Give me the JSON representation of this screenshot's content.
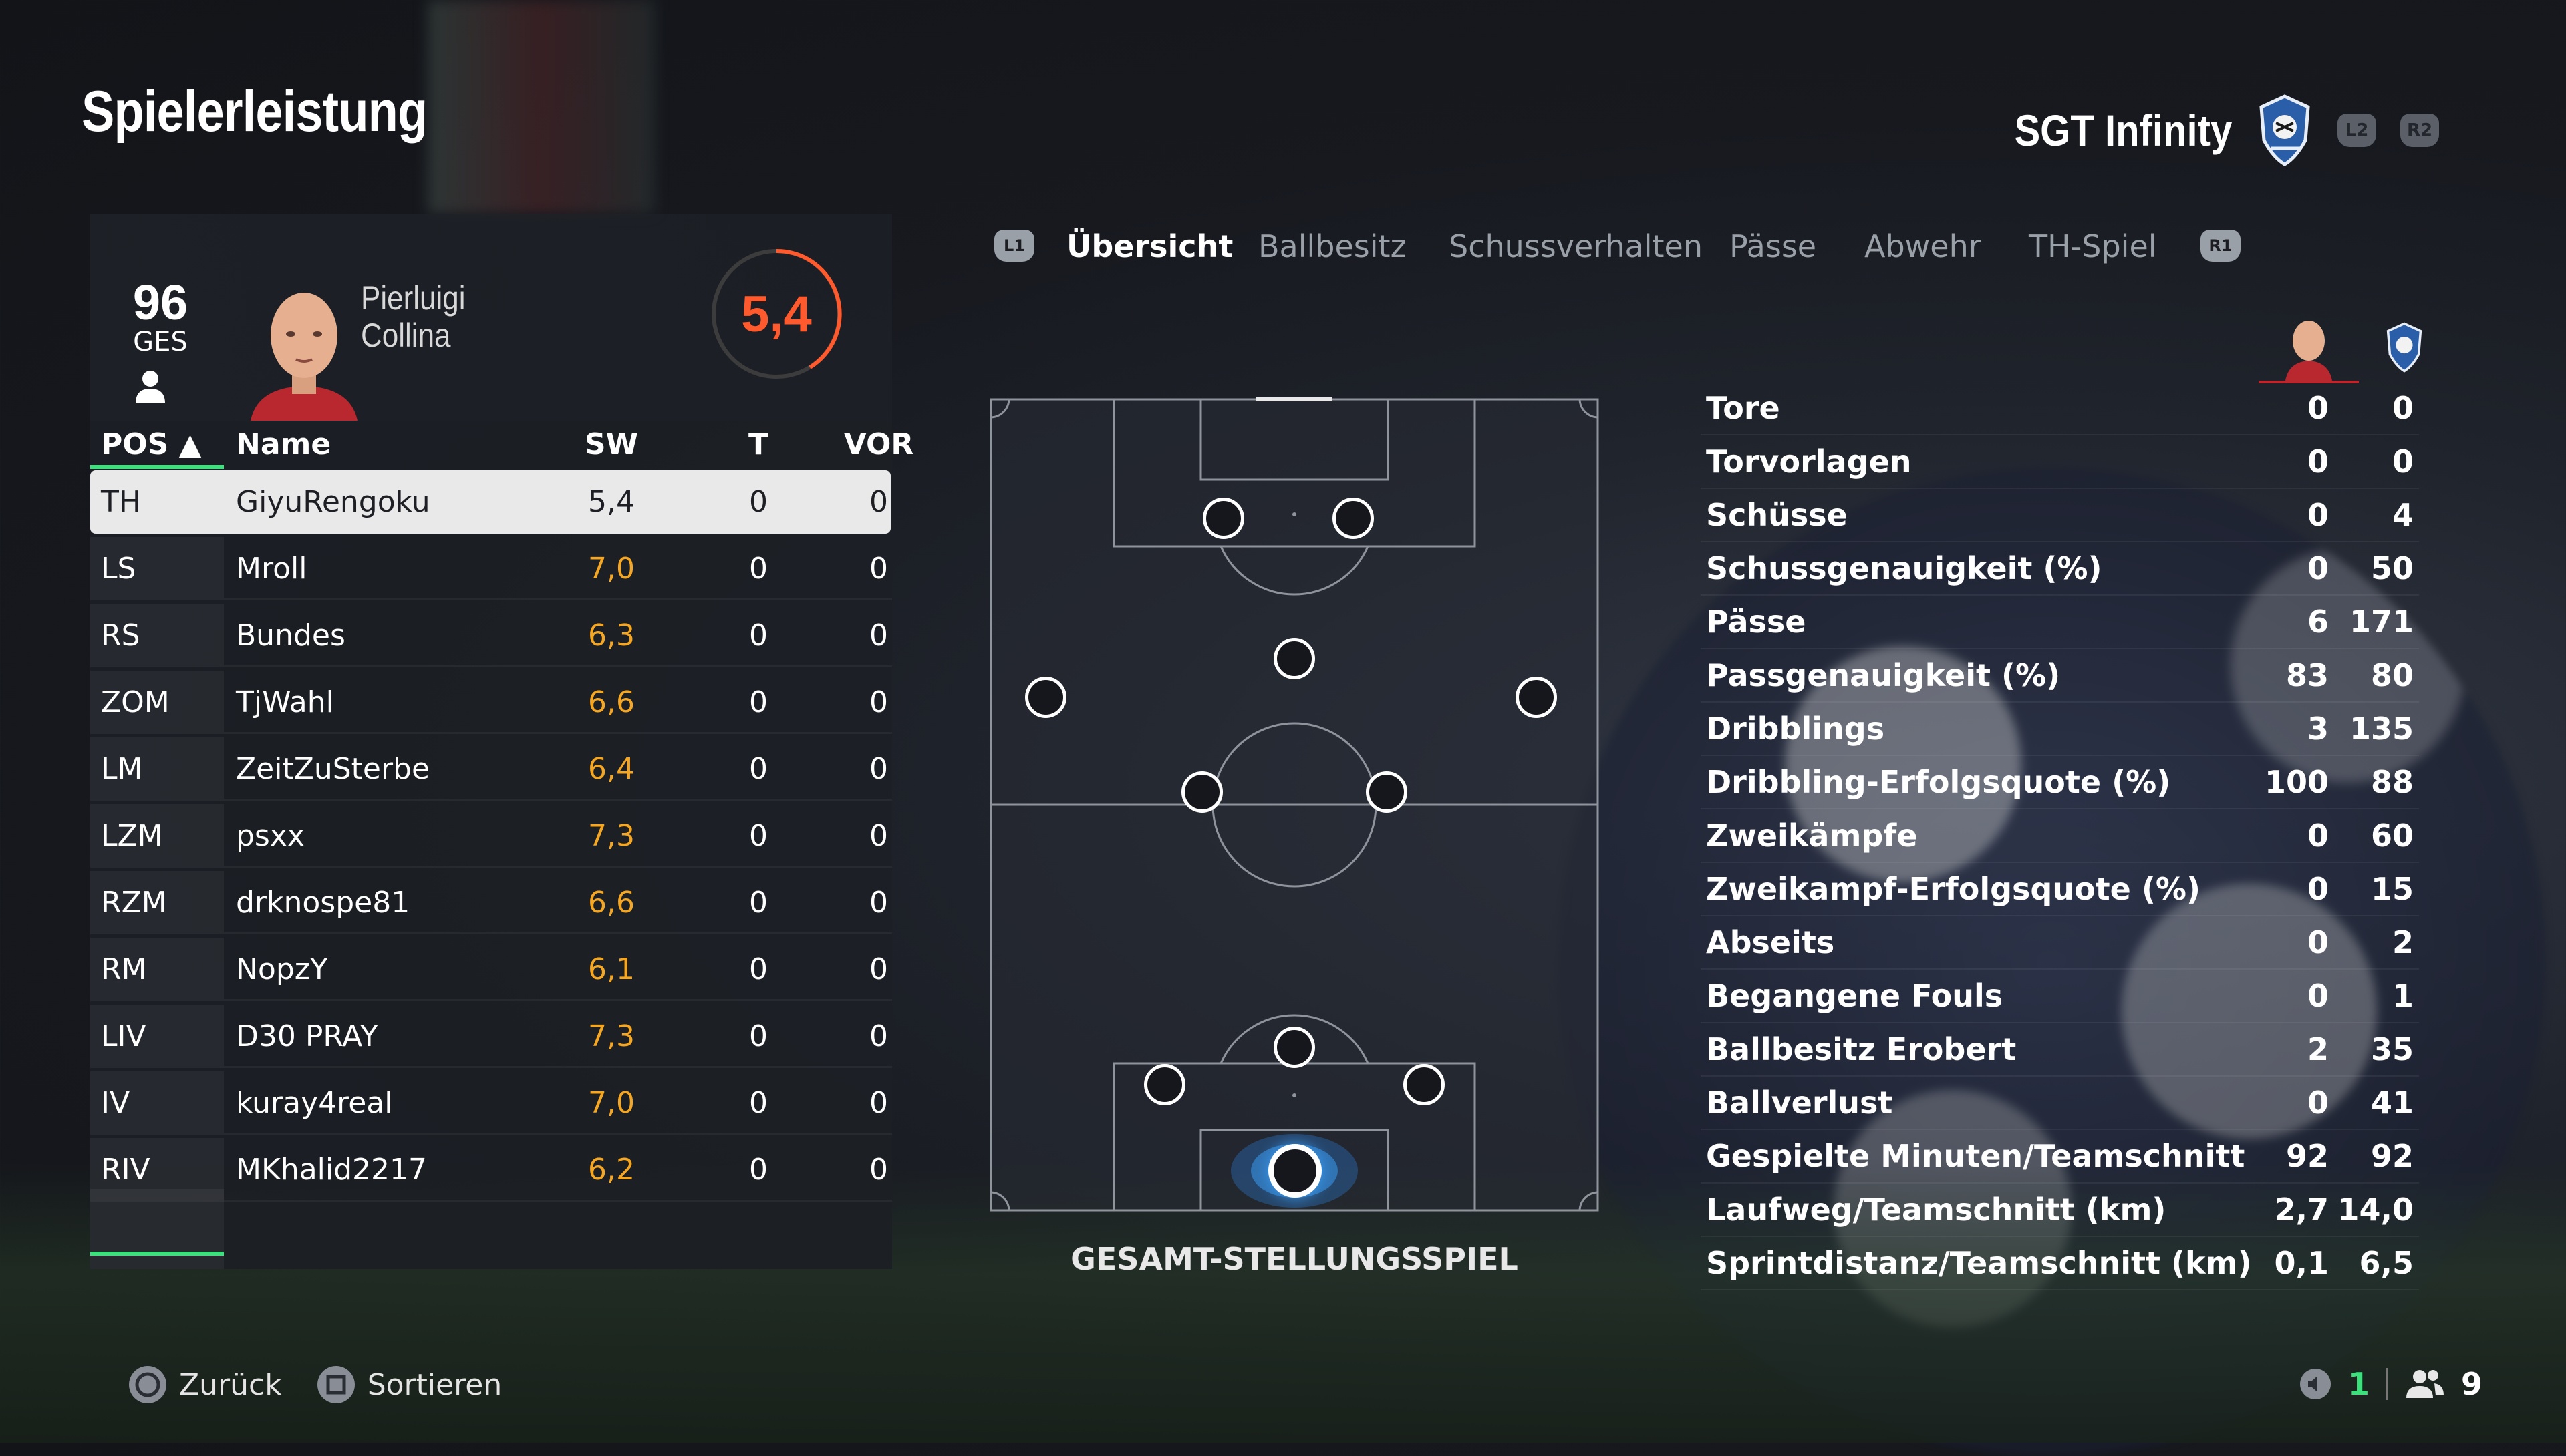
{
  "header": {
    "title": "Spielerleistung",
    "team_name": "SGT Infinity",
    "l2": "L2",
    "r2": "R2"
  },
  "player": {
    "overall": "96",
    "overall_label": "GES",
    "first_name": "Pierluigi",
    "last_name": "Collina",
    "match_rating": "5,4"
  },
  "roster": {
    "columns": {
      "pos": "POS ▲",
      "name": "Name",
      "sw": "SW",
      "t": "T",
      "vor": "VOR"
    },
    "rows": [
      {
        "pos": "TH",
        "name": "GiyuRengoku",
        "sw": "5,4",
        "t": "0",
        "vor": "0"
      },
      {
        "pos": "LS",
        "name": "Mroll",
        "sw": "7,0",
        "t": "0",
        "vor": "0"
      },
      {
        "pos": "RS",
        "name": "Bundes",
        "sw": "6,3",
        "t": "0",
        "vor": "0"
      },
      {
        "pos": "ZOM",
        "name": "TjWahl",
        "sw": "6,6",
        "t": "0",
        "vor": "0"
      },
      {
        "pos": "LM",
        "name": "ZeitZuSterbe",
        "sw": "6,4",
        "t": "0",
        "vor": "0"
      },
      {
        "pos": "LZM",
        "name": "psxx",
        "sw": "7,3",
        "t": "0",
        "vor": "0"
      },
      {
        "pos": "RZM",
        "name": "drknospe81",
        "sw": "6,6",
        "t": "0",
        "vor": "0"
      },
      {
        "pos": "RM",
        "name": "NopzY",
        "sw": "6,1",
        "t": "0",
        "vor": "0"
      },
      {
        "pos": "LIV",
        "name": "D30 PRAY",
        "sw": "7,3",
        "t": "0",
        "vor": "0"
      },
      {
        "pos": "IV",
        "name": "kuray4real",
        "sw": "7,0",
        "t": "0",
        "vor": "0"
      },
      {
        "pos": "RIV",
        "name": "MKhalid2217",
        "sw": "6,2",
        "t": "0",
        "vor": "0"
      }
    ]
  },
  "tabs": {
    "l1": "L1",
    "r1": "R1",
    "items": [
      "Übersicht",
      "Ballbesitz",
      "Schussverhalten",
      "Pässe",
      "Abwehr",
      "TH-Spiel"
    ],
    "active": "Übersicht"
  },
  "pitch": {
    "caption": "GESAMT-STELLUNGSSPIEL"
  },
  "stats": [
    {
      "label": "Tore",
      "player": "0",
      "team": "0"
    },
    {
      "label": "Torvorlagen",
      "player": "0",
      "team": "0"
    },
    {
      "label": "Schüsse",
      "player": "0",
      "team": "4"
    },
    {
      "label": "Schussgenauigkeit (%)",
      "player": "0",
      "team": "50"
    },
    {
      "label": "Pässe",
      "player": "6",
      "team": "171"
    },
    {
      "label": "Passgenauigkeit (%)",
      "player": "83",
      "team": "80"
    },
    {
      "label": "Dribblings",
      "player": "3",
      "team": "135"
    },
    {
      "label": "Dribbling-Erfolgsquote (%)",
      "player": "100",
      "team": "88"
    },
    {
      "label": "Zweikämpfe",
      "player": "0",
      "team": "60"
    },
    {
      "label": "Zweikampf-Erfolgsquote (%)",
      "player": "0",
      "team": "15"
    },
    {
      "label": "Abseits",
      "player": "0",
      "team": "2"
    },
    {
      "label": "Begangene Fouls",
      "player": "0",
      "team": "1"
    },
    {
      "label": "Ballbesitz Erobert",
      "player": "2",
      "team": "35"
    },
    {
      "label": "Ballverlust",
      "player": "0",
      "team": "41"
    },
    {
      "label": "Gespielte Minuten/Teamschnitt",
      "player": "92",
      "team": "92"
    },
    {
      "label": "Laufweg/Teamschnitt (km)",
      "player": "2,7",
      "team": "14,0"
    },
    {
      "label": "Sprintdistanz/Teamschnitt (km)",
      "player": "0,1",
      "team": "6,5"
    }
  ],
  "footer": {
    "back": "Zurück",
    "sort": "Sortieren",
    "speaker_count": "1",
    "party_count": "9"
  },
  "colors": {
    "accent_green": "#3ee07d",
    "rating_orange": "#ff5a2e",
    "sw_orange": "#f5a623"
  }
}
